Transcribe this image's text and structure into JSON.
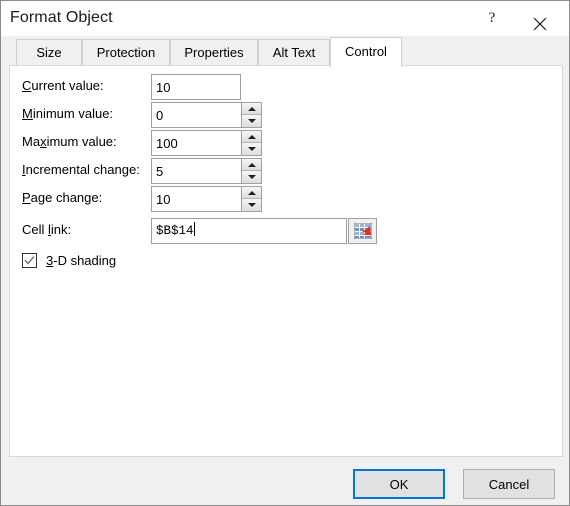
{
  "window": {
    "title": "Format Object",
    "help_label": "?",
    "help_icon": "question-mark-icon",
    "close_icon": "close-x-icon"
  },
  "tabs": [
    {
      "label": "Size",
      "active": false
    },
    {
      "label": "Protection",
      "active": false
    },
    {
      "label": "Properties",
      "active": false
    },
    {
      "label": "Alt Text",
      "active": false
    },
    {
      "label": "Control",
      "active": true
    }
  ],
  "form": {
    "fields": [
      {
        "name": "current-value",
        "label_pre": "",
        "label_accel": "C",
        "label_post": "urrent value:",
        "value": "10",
        "has_spinner": false
      },
      {
        "name": "minimum-value",
        "label_pre": "",
        "label_accel": "M",
        "label_post": "inimum value:",
        "value": "0",
        "has_spinner": true
      },
      {
        "name": "maximum-value",
        "label_pre": "Ma",
        "label_accel": "x",
        "label_post": "imum value:",
        "value": "100",
        "has_spinner": true
      },
      {
        "name": "incremental-change",
        "label_pre": "",
        "label_accel": "I",
        "label_post": "ncremental change:",
        "value": "5",
        "has_spinner": true
      },
      {
        "name": "page-change",
        "label_pre": "",
        "label_accel": "P",
        "label_post": "age change:",
        "value": "10",
        "has_spinner": true
      }
    ],
    "cell_link": {
      "label_pre": "Cell ",
      "label_accel": "l",
      "label_post": "ink:",
      "value": "$B$14",
      "picker_icon": "range-select-icon"
    },
    "shading_checkbox": {
      "label_pre": "",
      "label_accel": "3",
      "label_post": "-D shading",
      "checked": true
    }
  },
  "footer": {
    "ok_label": "OK",
    "cancel_label": "Cancel"
  },
  "colors": {
    "accent": "#0078d7",
    "dialog_bg": "#f0f0f0",
    "panel_bg": "#ffffff",
    "icon_red": "#e03020"
  }
}
